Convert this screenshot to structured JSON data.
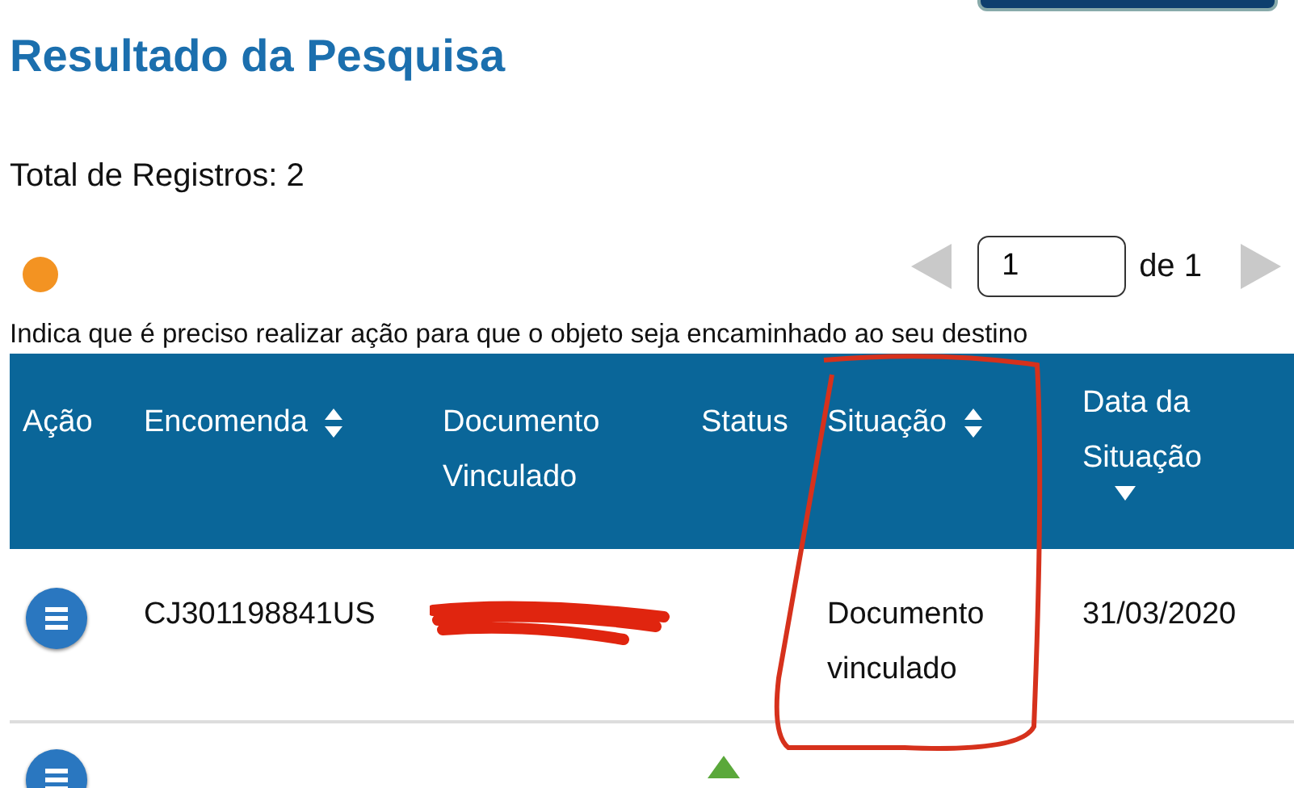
{
  "title": "Resultado da Pesquisa",
  "total": "Total de Registros: 2",
  "legend": {
    "color": "#f39322",
    "text": "Indica que é preciso realizar ação para que o objeto seja encaminhado ao seu destino"
  },
  "pager": {
    "page": "1",
    "of_label": "de 1"
  },
  "table": {
    "columns": [
      {
        "label": "Ação",
        "sortable": false
      },
      {
        "label": "Encomenda",
        "sortable": true,
        "sorted_descending": false
      },
      {
        "label": "Documento Vinculado",
        "sortable": false
      },
      {
        "label": "Status",
        "sortable": false
      },
      {
        "label": "Situação",
        "sortable": true,
        "sorted_descending": false
      },
      {
        "label": "Data da Situação",
        "sortable": true,
        "sorted_descending": true
      }
    ],
    "rows": [
      {
        "kind": "full",
        "encomenda": "CJ301198841US",
        "document_redacted": true,
        "situacao": "Documento vinculado",
        "data": "31/03/2020"
      },
      {
        "kind": "cut",
        "status_icon": true
      }
    ]
  },
  "markup": {
    "color": "#d6311c"
  }
}
